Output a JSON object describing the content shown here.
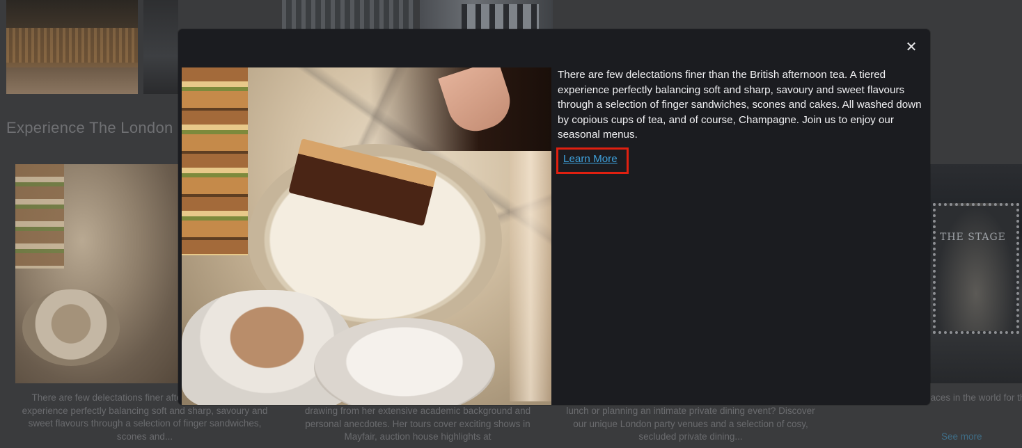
{
  "background": {
    "section_heading": "Experience The London",
    "stage_sign": "THE STAGE",
    "cards": [
      {
        "text": "There are few delectations finer afternoon tea. A tiered experience perfectly balancing soft and sharp, savoury and sweet flavours through a selection of finger sandwiches, scones and..."
      },
      {
        "text": "drawing from her extensive academic background and personal anecdotes. Her tours cover exciting shows in Mayfair, auction house highlights at"
      },
      {
        "text": "lunch or planning an intimate private dining event? Discover our unique London party venues and a selection of cosy, secluded private dining..."
      },
      {
        "text": "ing that London is or places in the world for theatre. There are the West End alone, and another 20",
        "link": "See more"
      }
    ]
  },
  "modal": {
    "close_icon": "close-icon",
    "close_symbol": "✕",
    "description": "There are few delectations finer than the British afternoon tea. A tiered experience perfectly balancing soft and sharp, savoury and sweet flavours through a selection of finger sandwiches, scones and cakes. All washed down by copious cups of tea, and of course, Champagne. Join us to enjoy our seasonal menus.",
    "learn_more_label": "Learn More",
    "highlight_color": "#e02010",
    "link_color": "#3fa2dd"
  }
}
